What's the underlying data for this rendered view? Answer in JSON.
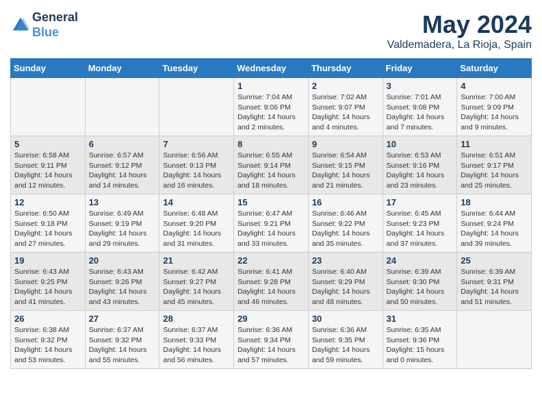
{
  "header": {
    "logo_line1": "General",
    "logo_line2": "Blue",
    "month": "May 2024",
    "location": "Valdemadera, La Rioja, Spain"
  },
  "days_of_week": [
    "Sunday",
    "Monday",
    "Tuesday",
    "Wednesday",
    "Thursday",
    "Friday",
    "Saturday"
  ],
  "weeks": [
    [
      {
        "day": "",
        "sunrise": "",
        "sunset": "",
        "daylight": ""
      },
      {
        "day": "",
        "sunrise": "",
        "sunset": "",
        "daylight": ""
      },
      {
        "day": "",
        "sunrise": "",
        "sunset": "",
        "daylight": ""
      },
      {
        "day": "1",
        "sunrise": "Sunrise: 7:04 AM",
        "sunset": "Sunset: 9:06 PM",
        "daylight": "Daylight: 14 hours and 2 minutes."
      },
      {
        "day": "2",
        "sunrise": "Sunrise: 7:02 AM",
        "sunset": "Sunset: 9:07 PM",
        "daylight": "Daylight: 14 hours and 4 minutes."
      },
      {
        "day": "3",
        "sunrise": "Sunrise: 7:01 AM",
        "sunset": "Sunset: 9:08 PM",
        "daylight": "Daylight: 14 hours and 7 minutes."
      },
      {
        "day": "4",
        "sunrise": "Sunrise: 7:00 AM",
        "sunset": "Sunset: 9:09 PM",
        "daylight": "Daylight: 14 hours and 9 minutes."
      }
    ],
    [
      {
        "day": "5",
        "sunrise": "Sunrise: 6:58 AM",
        "sunset": "Sunset: 9:11 PM",
        "daylight": "Daylight: 14 hours and 12 minutes."
      },
      {
        "day": "6",
        "sunrise": "Sunrise: 6:57 AM",
        "sunset": "Sunset: 9:12 PM",
        "daylight": "Daylight: 14 hours and 14 minutes."
      },
      {
        "day": "7",
        "sunrise": "Sunrise: 6:56 AM",
        "sunset": "Sunset: 9:13 PM",
        "daylight": "Daylight: 14 hours and 16 minutes."
      },
      {
        "day": "8",
        "sunrise": "Sunrise: 6:55 AM",
        "sunset": "Sunset: 9:14 PM",
        "daylight": "Daylight: 14 hours and 18 minutes."
      },
      {
        "day": "9",
        "sunrise": "Sunrise: 6:54 AM",
        "sunset": "Sunset: 9:15 PM",
        "daylight": "Daylight: 14 hours and 21 minutes."
      },
      {
        "day": "10",
        "sunrise": "Sunrise: 6:53 AM",
        "sunset": "Sunset: 9:16 PM",
        "daylight": "Daylight: 14 hours and 23 minutes."
      },
      {
        "day": "11",
        "sunrise": "Sunrise: 6:51 AM",
        "sunset": "Sunset: 9:17 PM",
        "daylight": "Daylight: 14 hours and 25 minutes."
      }
    ],
    [
      {
        "day": "12",
        "sunrise": "Sunrise: 6:50 AM",
        "sunset": "Sunset: 9:18 PM",
        "daylight": "Daylight: 14 hours and 27 minutes."
      },
      {
        "day": "13",
        "sunrise": "Sunrise: 6:49 AM",
        "sunset": "Sunset: 9:19 PM",
        "daylight": "Daylight: 14 hours and 29 minutes."
      },
      {
        "day": "14",
        "sunrise": "Sunrise: 6:48 AM",
        "sunset": "Sunset: 9:20 PM",
        "daylight": "Daylight: 14 hours and 31 minutes."
      },
      {
        "day": "15",
        "sunrise": "Sunrise: 6:47 AM",
        "sunset": "Sunset: 9:21 PM",
        "daylight": "Daylight: 14 hours and 33 minutes."
      },
      {
        "day": "16",
        "sunrise": "Sunrise: 6:46 AM",
        "sunset": "Sunset: 9:22 PM",
        "daylight": "Daylight: 14 hours and 35 minutes."
      },
      {
        "day": "17",
        "sunrise": "Sunrise: 6:45 AM",
        "sunset": "Sunset: 9:23 PM",
        "daylight": "Daylight: 14 hours and 37 minutes."
      },
      {
        "day": "18",
        "sunrise": "Sunrise: 6:44 AM",
        "sunset": "Sunset: 9:24 PM",
        "daylight": "Daylight: 14 hours and 39 minutes."
      }
    ],
    [
      {
        "day": "19",
        "sunrise": "Sunrise: 6:43 AM",
        "sunset": "Sunset: 9:25 PM",
        "daylight": "Daylight: 14 hours and 41 minutes."
      },
      {
        "day": "20",
        "sunrise": "Sunrise: 6:43 AM",
        "sunset": "Sunset: 9:26 PM",
        "daylight": "Daylight: 14 hours and 43 minutes."
      },
      {
        "day": "21",
        "sunrise": "Sunrise: 6:42 AM",
        "sunset": "Sunset: 9:27 PM",
        "daylight": "Daylight: 14 hours and 45 minutes."
      },
      {
        "day": "22",
        "sunrise": "Sunrise: 6:41 AM",
        "sunset": "Sunset: 9:28 PM",
        "daylight": "Daylight: 14 hours and 46 minutes."
      },
      {
        "day": "23",
        "sunrise": "Sunrise: 6:40 AM",
        "sunset": "Sunset: 9:29 PM",
        "daylight": "Daylight: 14 hours and 48 minutes."
      },
      {
        "day": "24",
        "sunrise": "Sunrise: 6:39 AM",
        "sunset": "Sunset: 9:30 PM",
        "daylight": "Daylight: 14 hours and 50 minutes."
      },
      {
        "day": "25",
        "sunrise": "Sunrise: 6:39 AM",
        "sunset": "Sunset: 9:31 PM",
        "daylight": "Daylight: 14 hours and 51 minutes."
      }
    ],
    [
      {
        "day": "26",
        "sunrise": "Sunrise: 6:38 AM",
        "sunset": "Sunset: 9:32 PM",
        "daylight": "Daylight: 14 hours and 53 minutes."
      },
      {
        "day": "27",
        "sunrise": "Sunrise: 6:37 AM",
        "sunset": "Sunset: 9:32 PM",
        "daylight": "Daylight: 14 hours and 55 minutes."
      },
      {
        "day": "28",
        "sunrise": "Sunrise: 6:37 AM",
        "sunset": "Sunset: 9:33 PM",
        "daylight": "Daylight: 14 hours and 56 minutes."
      },
      {
        "day": "29",
        "sunrise": "Sunrise: 6:36 AM",
        "sunset": "Sunset: 9:34 PM",
        "daylight": "Daylight: 14 hours and 57 minutes."
      },
      {
        "day": "30",
        "sunrise": "Sunrise: 6:36 AM",
        "sunset": "Sunset: 9:35 PM",
        "daylight": "Daylight: 14 hours and 59 minutes."
      },
      {
        "day": "31",
        "sunrise": "Sunrise: 6:35 AM",
        "sunset": "Sunset: 9:36 PM",
        "daylight": "Daylight: 15 hours and 0 minutes."
      },
      {
        "day": "",
        "sunrise": "",
        "sunset": "",
        "daylight": ""
      }
    ]
  ]
}
